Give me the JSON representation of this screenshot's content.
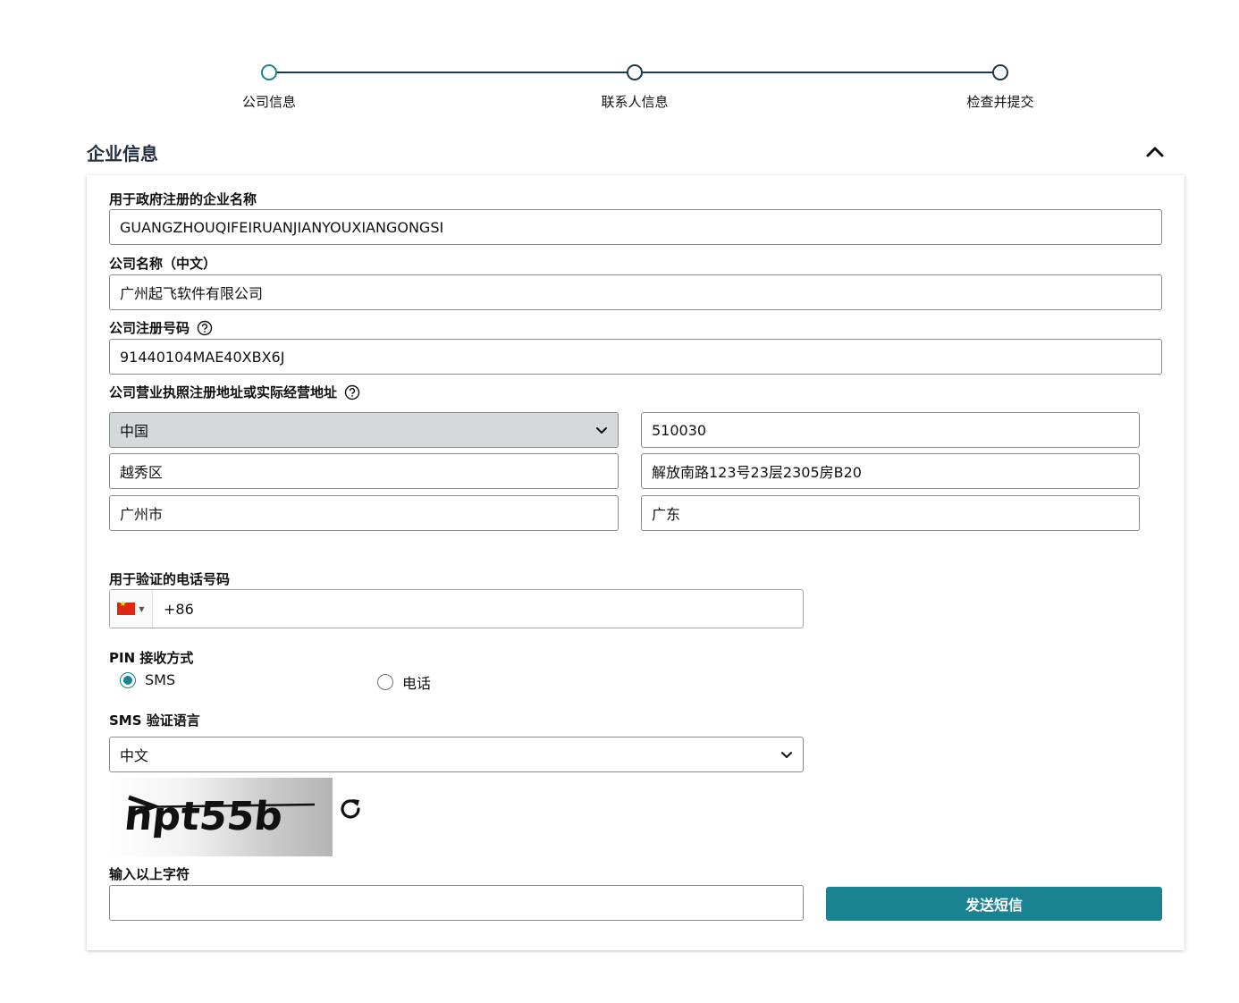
{
  "stepper": {
    "steps": [
      {
        "label": "公司信息",
        "active": true
      },
      {
        "label": "联系人信息",
        "active": false
      },
      {
        "label": "检查并提交",
        "active": false
      }
    ]
  },
  "section": {
    "title": "企业信息"
  },
  "form": {
    "legal_name": {
      "label": "用于政府注册的企业名称",
      "value": "GUANGZHOUQIFEIRUANJIANYOUXIANGONGSI"
    },
    "chinese_name": {
      "label": "公司名称（中文）",
      "value": "广州起飞软件有限公司"
    },
    "registration_number": {
      "label": "公司注册号码",
      "value": "91440104MAE40XBX6J"
    },
    "address": {
      "label": "公司营业执照注册地址或实际经营地址",
      "country": "中国",
      "postal_code": "510030",
      "district": "越秀区",
      "street": "解放南路123号23层2305房B20",
      "city": "广州市",
      "province": "广东"
    },
    "phone": {
      "label": "用于验证的电话号码",
      "value": "+86"
    },
    "pin_method": {
      "label": "PIN 接收方式",
      "options": [
        "SMS",
        "电话"
      ],
      "selected": "SMS"
    },
    "sms_language": {
      "label": "SMS 验证语言",
      "value": "中文"
    },
    "captcha": {
      "text": "npt55b",
      "input_label": "输入以上字符",
      "input_value": ""
    },
    "send_button": "发送短信"
  },
  "colors": {
    "accent": "#1a8291",
    "dark": "#1b3a4b"
  }
}
